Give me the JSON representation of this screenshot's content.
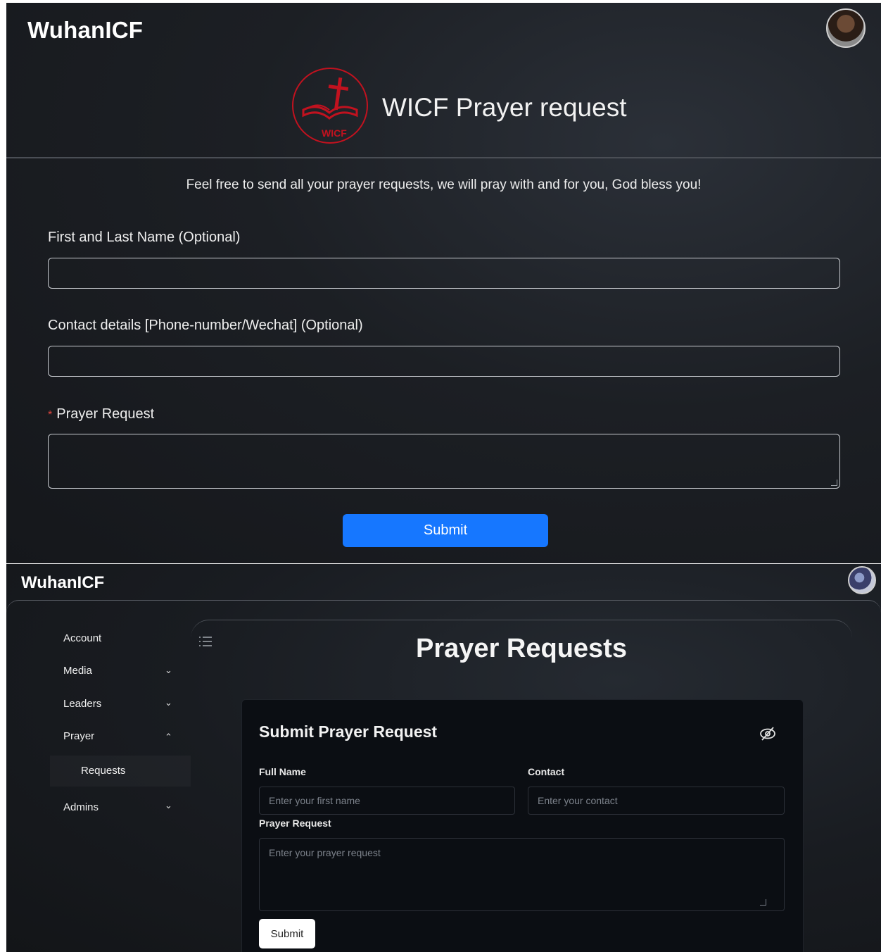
{
  "public_form": {
    "brand": "WuhanICF",
    "logo_text": "WICF",
    "headline": "WICF Prayer request",
    "intro": "Feel free to send all your prayer requests, we will pray with and for you, God bless you!",
    "fields": {
      "name_label": "First and Last Name (Optional)",
      "name_value": "",
      "contact_label": "Contact details [Phone-number/Wechat] (Optional)",
      "contact_value": "",
      "required_marker": "*",
      "prayer_label": "Prayer Request",
      "prayer_value": ""
    },
    "submit_label": "Submit",
    "colors": {
      "accent": "#1677ff",
      "logo": "#c1121f",
      "required": "#e0463f"
    }
  },
  "admin": {
    "brand": "WuhanICF",
    "page_title": "Prayer Requests",
    "sidebar": {
      "items": [
        {
          "label": "Account",
          "icon": ""
        },
        {
          "label": "Media",
          "icon": "chevron-down-icon"
        },
        {
          "label": "Leaders",
          "icon": "chevron-down-icon"
        },
        {
          "label": "Prayer",
          "icon": "chevron-up-icon"
        },
        {
          "label": "Admins",
          "icon": "chevron-down-icon"
        }
      ],
      "sub_items": [
        {
          "label": "Requests"
        }
      ]
    },
    "form": {
      "title": "Submit Prayer Request",
      "full_name_label": "Full Name",
      "full_name_placeholder": "Enter your first name",
      "contact_label": "Contact",
      "contact_placeholder": "Enter your contact",
      "prayer_label": "Prayer Request",
      "prayer_placeholder": "Enter your prayer request",
      "submit_label": "Submit",
      "visibility_icon": "eye-off-icon"
    }
  }
}
